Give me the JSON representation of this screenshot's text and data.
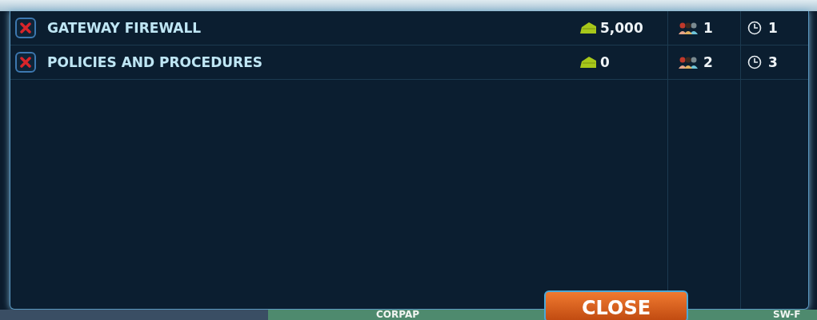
{
  "tasks": [
    {
      "name": "GATEWAY FIREWALL",
      "cost": "5,000",
      "staff": "1",
      "time": "1"
    },
    {
      "name": "POLICIES AND PROCEDURES",
      "cost": "0",
      "staff": "2",
      "time": "3"
    }
  ],
  "bottom_bar": {
    "label": "CORPAP",
    "right_label": "SW-F"
  },
  "close_button": "CLOSE"
}
